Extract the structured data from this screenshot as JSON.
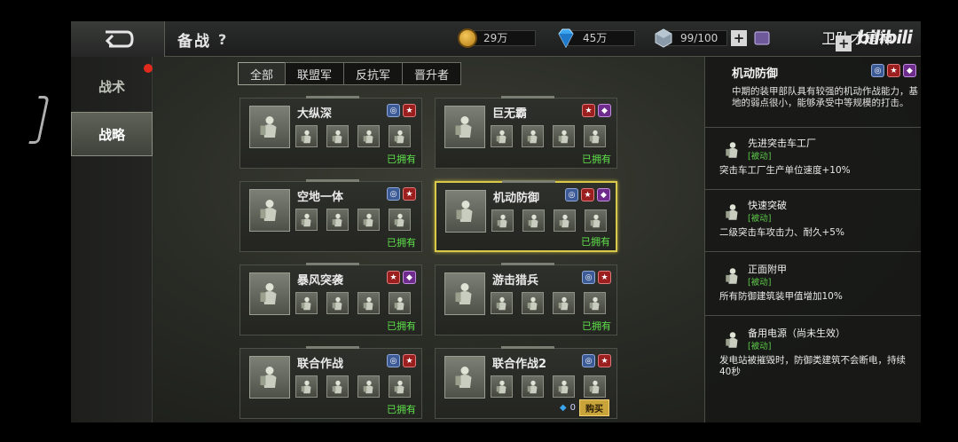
{
  "header": {
    "title": "备战",
    "help": "?",
    "gold": "29万",
    "diamonds": "45万",
    "supply": "99/100",
    "plus": "+",
    "watermark_text": "卫队才是神",
    "watermark_logo": "bilibili"
  },
  "left_tabs": [
    {
      "label": "战术"
    },
    {
      "label": "战略"
    }
  ],
  "filters": [
    {
      "label": "全部"
    },
    {
      "label": "联盟军"
    },
    {
      "label": "反抗军"
    },
    {
      "label": "晋升者"
    }
  ],
  "cards": [
    {
      "name": "大纵深",
      "factions": [
        "alliance",
        "soviet"
      ],
      "status": "已拥有"
    },
    {
      "name": "巨无霸",
      "factions": [
        "soviet",
        "empire"
      ],
      "status": "已拥有"
    },
    {
      "name": "空地一体",
      "factions": [
        "alliance",
        "soviet"
      ],
      "status": "已拥有"
    },
    {
      "name": "机动防御",
      "factions": [
        "alliance",
        "soviet",
        "empire"
      ],
      "status": "已拥有",
      "selected": true
    },
    {
      "name": "暴风突袭",
      "factions": [
        "soviet",
        "empire"
      ],
      "status": "已拥有"
    },
    {
      "name": "游击猎兵",
      "factions": [
        "alliance",
        "soviet"
      ],
      "status": "已拥有"
    },
    {
      "name": "联合作战",
      "factions": [
        "alliance",
        "soviet"
      ],
      "status": "已拥有"
    },
    {
      "name": "联合作战2",
      "factions": [
        "alliance",
        "soviet"
      ],
      "price": "0",
      "buy_label": "购买"
    }
  ],
  "detail": {
    "title": "机动防御",
    "factions": [
      "alliance",
      "soviet",
      "empire"
    ],
    "description": "中期的装甲部队具有较强的机动作战能力，基地的弱点很小，能够承受中等规模的打击。",
    "perks": [
      {
        "name": "先进突击车工厂",
        "tag": "[被动]",
        "effect": "突击车工厂生产单位速度+10%"
      },
      {
        "name": "快速突破",
        "tag": "[被动]",
        "effect": "二级突击车攻击力、耐久+5%"
      },
      {
        "name": "正面附甲",
        "tag": "[被动]",
        "effect": "所有防御建筑装甲值增加10%"
      },
      {
        "name": "备用电源（尚未生效）",
        "tag": "[被动]",
        "effect": "发电站被摧毁时，防御类建筑不会断电，持续40秒"
      }
    ]
  },
  "colors": {
    "owned": "#5ee04a",
    "selected_border": "#d9c94a",
    "alliance": "#3c5a96",
    "soviet": "#9c1f1f",
    "empire": "#6e2c8c"
  }
}
